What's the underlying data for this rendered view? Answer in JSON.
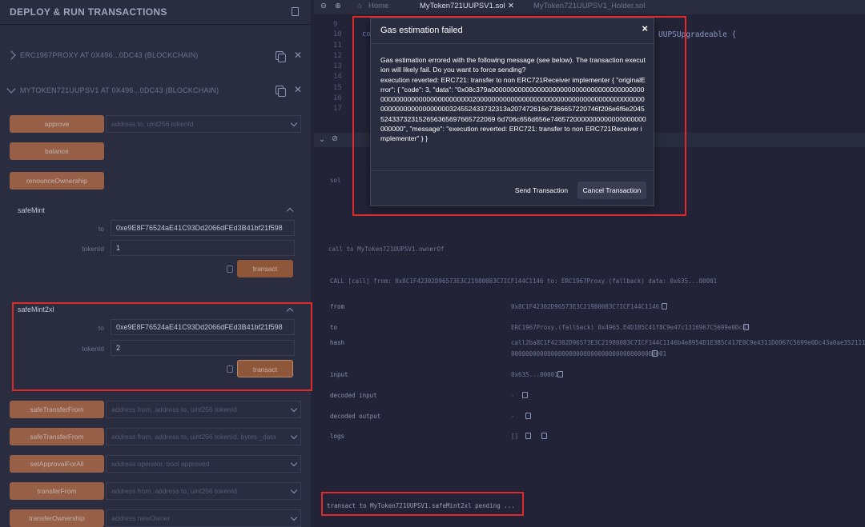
{
  "panel": {
    "title": "DEPLOY & RUN TRANSACTIONS",
    "instances": [
      {
        "label": "ERC1967PROXY AT 0X496...0DC43 (BLOCKCHAIN)"
      },
      {
        "label": "MYTOKEN721UUPSV1 AT 0X496...0DC43 (BLOCKCHAIN)"
      }
    ],
    "functions_top": [
      {
        "label": "approve",
        "placeholder": "address to, uint256 tokenId"
      },
      {
        "label": "balance",
        "placeholder": ""
      },
      {
        "label": "renounceOwnership",
        "placeholder": ""
      }
    ],
    "safeMint": {
      "title": "safeMint",
      "to_label": "to",
      "to_value": "0xe9E8F76524aE41C93Dd2066dFEd3B41bf21f598",
      "tokenid_label": "tokenId",
      "tokenid_value": "1",
      "transact": "transact"
    },
    "safeMint2x": {
      "title": "safeMint2xl",
      "to_label": "to",
      "to_value": "0xe9E8F76524aE41C93Dd2066dFEd3B41bf21f598",
      "tokenid_label": "tokenId",
      "tokenid_value": "2",
      "transact": "transact"
    },
    "functions_bottom": [
      {
        "label": "safeTransferFrom",
        "placeholder": "address from, address to, uint256 tokenId"
      },
      {
        "label": "safeTransferFrom",
        "placeholder": "address from, address to, uint256 tokenId, bytes _data"
      },
      {
        "label": "setApprovalForAll",
        "placeholder": "address operator, bool approved"
      },
      {
        "label": "transferFrom",
        "placeholder": "address from, address to, uint256 tokenId"
      },
      {
        "label": "transferOwnership",
        "placeholder": "address newOwner"
      }
    ]
  },
  "editor": {
    "tabs": [
      "Home",
      "MyToken721UUPSV1.sol",
      "MyToken721UUPSV1_Holder.sol"
    ],
    "line_numbers": [
      "9",
      "10",
      "11",
      "12",
      "13",
      "14",
      "15",
      "16",
      "17"
    ],
    "code_left": "co",
    "code_right": "UUPSUpgradeable {"
  },
  "terminal": {
    "lines": {
      "sol": "sol",
      "call": "call to MyToken721UUPSV1.ownerOf",
      "call_detail": "CALL   [call]  from: 0x8C1F42302D96573E3C21980083C7ICF144C1146 to: ERC1967Proxy.(fallback) data: 0x635...00001",
      "pending": "transact to MyToken721UUPSV1.safeMint2xl pending ..."
    },
    "rows": [
      {
        "key": "from",
        "value": "0x8C1F42302D96573E3C21980083C7ICF144C1146"
      },
      {
        "key": "to",
        "value": "ERC1967Proxy.(fallback) 0x4965.E4D1B5C41f8C9e47c1316967C5699e0Dc43"
      },
      {
        "key": "hash",
        "value": "call2ba8C1F42302D96573E3C21980083C7ICF144C1146b4e8954D1E3B5C417E0C9e4311D0967C5699e0Dc43a0ae352111a000000"
      },
      {
        "key": "hash2",
        "value": "0000000000000000000000000000000000000000001"
      },
      {
        "key": "input",
        "value": "0x635...00001"
      },
      {
        "key": "decoded input",
        "value": "-"
      },
      {
        "key": "decoded output",
        "value": "-"
      },
      {
        "key": "logs",
        "value": "[]"
      }
    ]
  },
  "modal": {
    "title": "Gas estimation failed",
    "close": "×",
    "body": "Gas estimation errored with the following message (see below). The transaction execution will likely fail. Do you want to force sending?\nexecution reverted: ERC721: transfer to non ERC721Receiver implementer { \"originalError\": { \"code\": 3, \"data\": \"0x08c379a0000000000000000000000000000000000000000000000000000000000000000200000000000000000000000000000000000000000000000000000000000000324552433732313a207472616e7366657220746f206e6f6e2045524337323152656365697665722069 6d706c656d656e7465720000000000000000000000000\", \"message\": \"execution reverted: ERC721: transfer to non ERC721Receiver implementer\" } }",
    "send_label": "Send Transaction",
    "cancel_label": "Cancel Transaction"
  },
  "colors": {
    "highlight": "#e02a2a",
    "function_button": "#c2734a",
    "panel_bg": "#2a2c3f"
  }
}
